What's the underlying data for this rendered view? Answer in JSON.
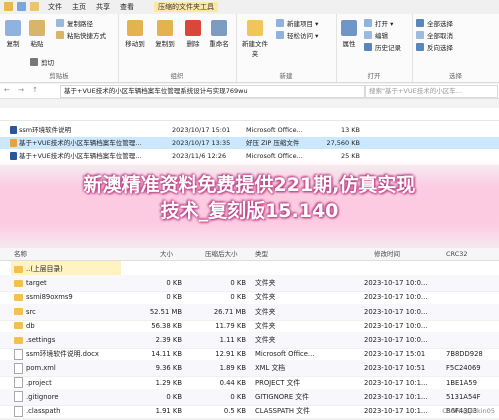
{
  "titlebar": {
    "tabs": [
      "文件",
      "主页",
      "共享",
      "查看"
    ],
    "window_title": "压缩的文件夹工具"
  },
  "ribbon": {
    "clipboard": {
      "group": "剪贴板",
      "copy": "复制",
      "paste": "粘贴",
      "cut": "剪切",
      "copy_path": "复制路径",
      "paste_shortcut": "粘贴快捷方式"
    },
    "organize": {
      "group": "组织",
      "move_to": "移动到",
      "copy_to": "复制到",
      "delete": "删除",
      "rename": "重命名"
    },
    "new": {
      "group": "新建",
      "new_folder": "新建文件夹",
      "new_item": "新建项目 ▾",
      "easy_access": "轻松访问 ▾"
    },
    "open": {
      "group": "打开",
      "properties": "属性",
      "open": "打开 ▾",
      "edit": "编辑",
      "history": "历史记录"
    },
    "select": {
      "group": "选择",
      "select_all": "全部选择",
      "select_none": "全部取消",
      "invert": "反向选择"
    }
  },
  "address": {
    "nav": "← → ↑",
    "path": "基于+VUE技术的小区车辆档案车位管理系统设计与实现769wu",
    "search_placeholder": "搜索\"基于+VUE技术的小区车..."
  },
  "top_files": [
    {
      "name": "ssm环境软件说明",
      "date": "2023/10/17 15:01",
      "type": "Microsoft Office...",
      "size": "13 KB",
      "icon_color": "#2b579a"
    },
    {
      "name": "基于+VUE技术的小区车辆档案车位管理...",
      "date": "2023/10/17 13:35",
      "type": "好压 ZIP 压缩文件",
      "size": "27,560 KB",
      "icon_color": "#e8a33d",
      "selected": true
    },
    {
      "name": "基于+VUE技术的小区车辆档案车位管理...",
      "date": "2023/11/6 12:26",
      "type": "Microsoft Office...",
      "size": "25 KB",
      "icon_color": "#2b579a"
    }
  ],
  "banner": {
    "line1": "新澳精准资料免费提供221期,仿真实现",
    "line2": "技术_复刻版15.140"
  },
  "list2": {
    "headers": [
      "名称",
      "大小",
      "压缩后大小",
      "类型",
      "修改时间",
      "CRC32"
    ],
    "rows": [
      {
        "name": "..(上层目录)",
        "size": "",
        "packed": "",
        "type": "",
        "mtime": "",
        "crc": "",
        "kind": "folder"
      },
      {
        "name": "target",
        "size": "0 KB",
        "packed": "0 KB",
        "type": "文件夹",
        "mtime": "2023-10-17 10:0...",
        "crc": "",
        "kind": "folder"
      },
      {
        "name": "ssmi89oxms9",
        "size": "0 KB",
        "packed": "0 KB",
        "type": "文件夹",
        "mtime": "2023-10-17 10:0...",
        "crc": "",
        "kind": "folder"
      },
      {
        "name": "src",
        "size": "52.51 MB",
        "packed": "26.71 MB",
        "type": "文件夹",
        "mtime": "2023-10-17 10:0...",
        "crc": "",
        "kind": "folder"
      },
      {
        "name": "db",
        "size": "56.38 KB",
        "packed": "11.79 KB",
        "type": "文件夹",
        "mtime": "2023-10-17 10:0...",
        "crc": "",
        "kind": "folder"
      },
      {
        "name": ".settings",
        "size": "2.39 KB",
        "packed": "1.11 KB",
        "type": "文件夹",
        "mtime": "2023-10-17 10:0...",
        "crc": "",
        "kind": "folder"
      },
      {
        "name": "ssm环境软件说明.docx",
        "size": "14.11 KB",
        "packed": "12.91 KB",
        "type": "Microsoft Office...",
        "mtime": "2023-10-17 15:01",
        "crc": "7B8DD928",
        "kind": "doc"
      },
      {
        "name": "pom.xml",
        "size": "9.36 KB",
        "packed": "1.89 KB",
        "type": "XML 文档",
        "mtime": "2023-10-17 10:51",
        "crc": "F5C24069",
        "kind": "doc"
      },
      {
        "name": ".project",
        "size": "1.29 KB",
        "packed": "0.44 KB",
        "type": "PROJECT 文件",
        "mtime": "2023-10-17 10:1...",
        "crc": "1BE1A59",
        "kind": "doc"
      },
      {
        "name": ".gitignore",
        "size": "0 KB",
        "packed": "0 KB",
        "type": "GITIGNORE 文件",
        "mtime": "2023-10-17 10:1...",
        "crc": "5131A54F",
        "kind": "doc"
      },
      {
        "name": ".classpath",
        "size": "1.91 KB",
        "packed": "0.5 KB",
        "type": "CLASSPATH 文件",
        "mtime": "2023-10-17 10:1...",
        "crc": "B6F43D3",
        "kind": "doc"
      }
    ]
  },
  "watermark": "CSDN @jinkin05"
}
